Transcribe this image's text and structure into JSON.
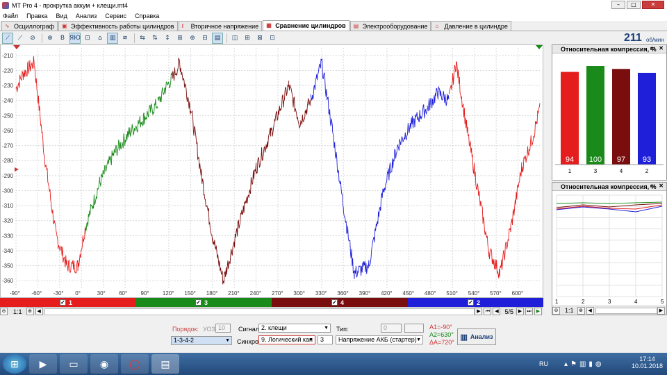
{
  "window": {
    "title": "MT Pro 4 - прокрутка аккум + клещи.mt4",
    "minimize": "–",
    "maximize": "□",
    "close": "✕"
  },
  "menu": [
    "Файл",
    "Правка",
    "Вид",
    "Анализ",
    "Сервис",
    "Справка"
  ],
  "tabs": [
    {
      "label": "Осциллограф",
      "icon": "∿"
    },
    {
      "label": "Эффективность работы цилиндров",
      "icon": "▣"
    },
    {
      "label": "Вторичное напряжение",
      "icon": "ℓ"
    },
    {
      "label": "Сравнение цилиндров",
      "icon": "▦"
    },
    {
      "label": "Электрооборудование",
      "icon": "▤"
    },
    {
      "label": "Давление в цилиндре",
      "icon": "⌂"
    }
  ],
  "active_tab": 3,
  "toolbar": [
    "⟋",
    "⟋",
    "⊘",
    "⊕",
    "B",
    "ЯЮ",
    "⊡",
    "⌂",
    "▥",
    "≋",
    "⇆",
    "⇅",
    "↕",
    "⊞",
    "⊕",
    "⊟",
    "▤",
    "◫",
    "⊞",
    "⊠",
    "⊡"
  ],
  "rpm": {
    "value": "211",
    "unit": "об/мин"
  },
  "chart_data": {
    "type": "line",
    "xlabel": "",
    "ylabel": "",
    "x_ticks": [
      "-90°",
      "-60°",
      "-30°",
      "0°",
      "30°",
      "60°",
      "90°",
      "120°",
      "150°",
      "180°",
      "210°",
      "240°",
      "270°",
      "300°",
      "330°",
      "360°",
      "390°",
      "420°",
      "450°",
      "480°",
      "510°",
      "540°",
      "570°",
      "600°"
    ],
    "y_ticks": [
      "-210",
      "-220",
      "-230",
      "-240",
      "-250",
      "-260",
      "-270",
      "-280",
      "-290",
      "-300",
      "-310",
      "-320",
      "-330",
      "-340",
      "-350",
      "-360"
    ],
    "xlim": [
      -90,
      630
    ],
    "ylim": [
      -365,
      -205
    ],
    "segments": [
      {
        "cylinder": "1",
        "color": "#e51d1d",
        "x": [
          -90,
          -80,
          -65,
          -50,
          -35,
          -20,
          -5,
          5
        ],
        "y": [
          -232,
          -222,
          -215,
          -280,
          -330,
          -350,
          -350,
          -325
        ]
      },
      {
        "cylinder": "3",
        "color": "#1a8a1a",
        "x": [
          5,
          25,
          45,
          65,
          85,
          105
        ],
        "y": [
          -325,
          -295,
          -275,
          -262,
          -252,
          -242
        ]
      },
      {
        "cylinder": "3b",
        "color": "#1a8a1a",
        "x": [
          105,
          115,
          125
        ],
        "y": [
          -242,
          -232,
          -225
        ]
      },
      {
        "cylinder": "4",
        "color": "#7a0e0e",
        "x": [
          125,
          135,
          150,
          165,
          180,
          195,
          215,
          240,
          260,
          285
        ],
        "y": [
          -225,
          -215,
          -245,
          -290,
          -330,
          -360,
          -325,
          -285,
          -262,
          -230
        ]
      },
      {
        "cylinder": "4b",
        "color": "#7a0e0e",
        "x": [
          285,
          300,
          315
        ],
        "y": [
          -230,
          -255,
          -240
        ]
      },
      {
        "cylinder": "2",
        "color": "#1f1fd9",
        "x": [
          315,
          330,
          345,
          360,
          375,
          395,
          415,
          435,
          455,
          475
        ],
        "y": [
          -240,
          -215,
          -260,
          -310,
          -355,
          -350,
          -300,
          -270,
          -255,
          -245
        ]
      },
      {
        "cylinder": "2b",
        "color": "#1f1fd9",
        "x": [
          475,
          490,
          505
        ],
        "y": [
          -245,
          -235,
          -240
        ]
      },
      {
        "cylinder": "1b",
        "color": "#e51d1d",
        "x": [
          505,
          515,
          530,
          545,
          560,
          575,
          590,
          605,
          620,
          630
        ],
        "y": [
          -240,
          -215,
          -260,
          -300,
          -340,
          -355,
          -325,
          -285,
          -265,
          -245
        ]
      }
    ],
    "cursor_a": "-90°",
    "cursor_b": "630°"
  },
  "legend": [
    {
      "label": "1",
      "color": "#e51d1d"
    },
    {
      "label": "3",
      "color": "#1a8a1a"
    },
    {
      "label": "4",
      "color": "#7a0e0e"
    },
    {
      "label": "2",
      "color": "#1f1fd9"
    }
  ],
  "scroll": {
    "zoom": "1:1",
    "page": "5/5"
  },
  "panel1": {
    "title": "Относительная компрессия, %",
    "bars": [
      {
        "label": "1",
        "value": 94,
        "color": "#e51d1d"
      },
      {
        "label": "3",
        "value": 100,
        "color": "#1a8a1a"
      },
      {
        "label": "4",
        "value": 97,
        "color": "#7a0e0e"
      },
      {
        "label": "2",
        "value": 93,
        "color": "#1f1fd9"
      }
    ]
  },
  "panel2": {
    "title": "Относительная компрессия, %",
    "x_ticks": [
      "1",
      "2",
      "3",
      "4",
      "5"
    ],
    "zoom": "1:1"
  },
  "controls": {
    "order_label": "Порядок:",
    "order_value": "1-3-4-2",
    "uoz_label": "УОЗ:",
    "uoz_value": "10",
    "signal_label": "Сигнал:",
    "signal_value": "2. клещи",
    "sync_label": "Синхро:",
    "sync_value": "9. Логический кан",
    "sync_num": "3",
    "type_label": "Тип:",
    "type_num": "0",
    "type_value": "Напряжение АКБ (стартер)",
    "a1": "A1=-90°",
    "a2": "A2=630°",
    "da": "ΔA=720°",
    "analysis_button": "Анализ"
  },
  "taskbar": {
    "lang": "RU",
    "time": "17:14",
    "date": "10.01.2018"
  }
}
